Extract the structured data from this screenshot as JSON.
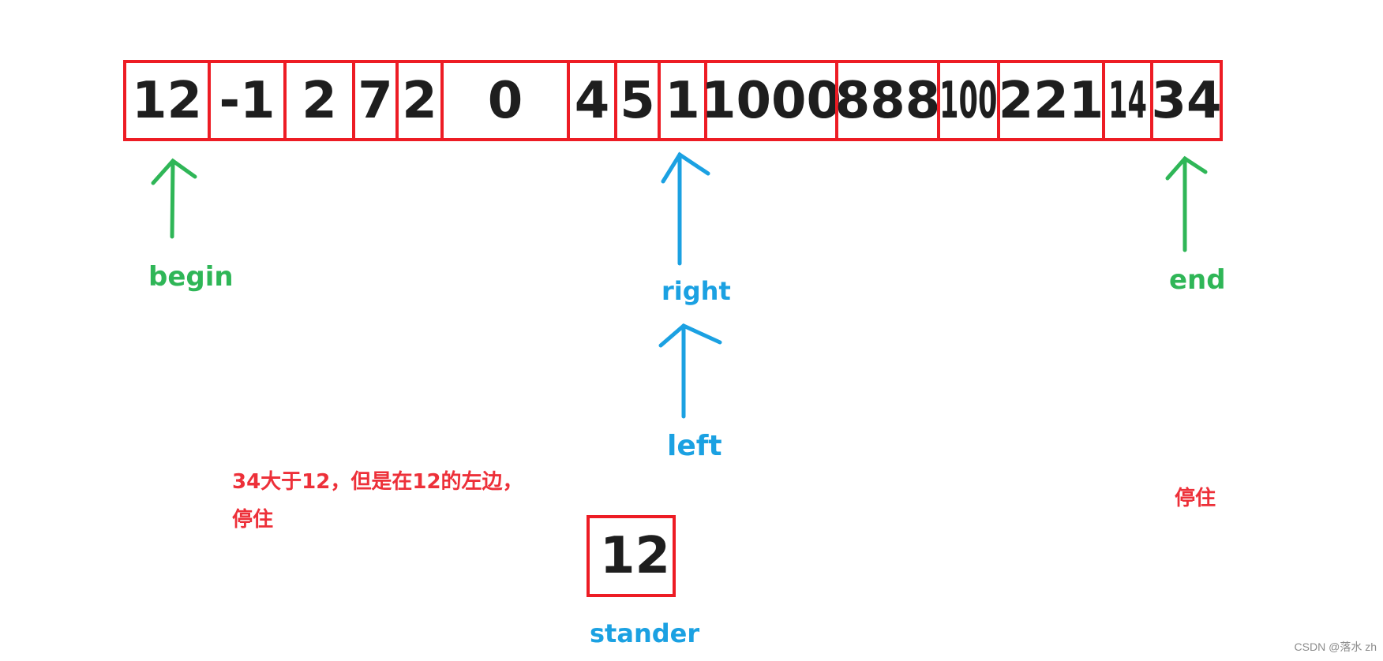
{
  "array": {
    "cells": [
      {
        "value": "12",
        "narrow": false
      },
      {
        "value": "-1",
        "narrow": false
      },
      {
        "value": "2",
        "narrow": false
      },
      {
        "value": "7",
        "narrow": false
      },
      {
        "value": "2",
        "narrow": false
      },
      {
        "value": "0",
        "narrow": false
      },
      {
        "value": "4",
        "narrow": false
      },
      {
        "value": "5",
        "narrow": false
      },
      {
        "value": "1",
        "narrow": false
      },
      {
        "value": "1000",
        "narrow": false
      },
      {
        "value": "888",
        "narrow": false
      },
      {
        "value": "100",
        "narrow": true
      },
      {
        "value": "221",
        "narrow": false
      },
      {
        "value": "14",
        "narrow": true
      },
      {
        "value": "34",
        "narrow": false
      }
    ]
  },
  "pointers": {
    "begin": {
      "label": "begin",
      "index": 0
    },
    "end": {
      "label": "end",
      "index": 14
    },
    "right": {
      "label": "right",
      "index": 8
    },
    "left": {
      "label": "left",
      "index": 8
    }
  },
  "pivot": {
    "label": "stander",
    "value": "12"
  },
  "notes": {
    "left_note_line1": "34大于12，但是在12的左边，",
    "left_note_line2": "停住",
    "right_note": "停住"
  },
  "colors": {
    "border": "#ed1c24",
    "begin_end": "#2fb657",
    "left_right": "#1ba1e2",
    "note": "#ed3039"
  },
  "watermark": "CSDN @落水 zh"
}
